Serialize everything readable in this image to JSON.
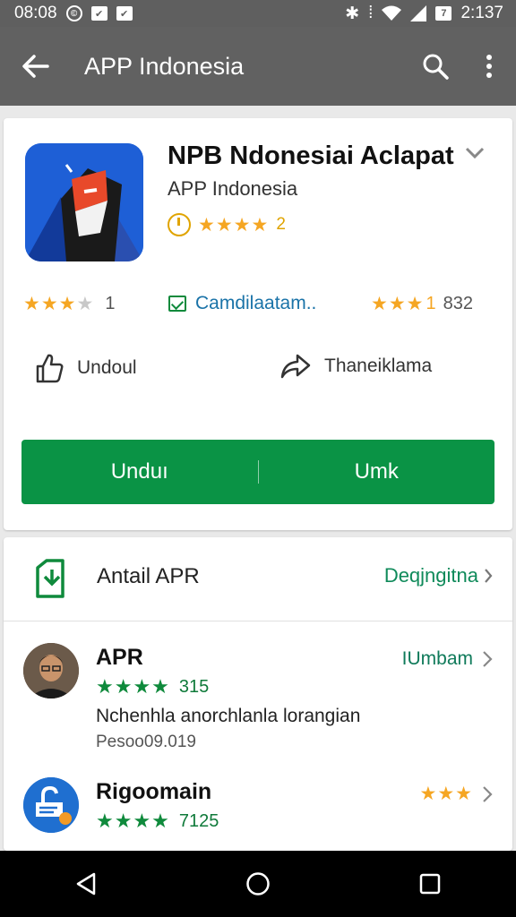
{
  "status_bar": {
    "time_left": "08:08",
    "time_right": "2:137",
    "battery_label": "7"
  },
  "app_bar": {
    "title": "APP Indonesia",
    "color": "#616161"
  },
  "app": {
    "name": "NPB Ndonesiai  Aclapat",
    "developer": "APP Indonesia",
    "rating_value": "2",
    "stat_left_count": "1",
    "stat_middle_label": "Camdilaatam..",
    "stat_right_count": "832",
    "stat_right_star_glyph": "1"
  },
  "actions": {
    "left_label": "Undoul",
    "right_label": "Thaneiklama"
  },
  "big_button": {
    "left_label": "Unduı",
    "right_label": "Umk",
    "color": "#0a9345"
  },
  "section": {
    "title": "Antail APR",
    "link_label": "Deqjngitna"
  },
  "list": [
    {
      "title": "APR",
      "rating_count": "315",
      "right_label": "IUmbam",
      "description": "Nchenhla anorchlanla lorangian",
      "meta": "Pesoo09.019"
    },
    {
      "title": "Rigoomain",
      "rating_count": "7125",
      "right_label": ""
    }
  ],
  "colors": {
    "accent_green": "#0a9345",
    "star_gold": "#f5a623",
    "link_blue": "#1a73a8"
  }
}
